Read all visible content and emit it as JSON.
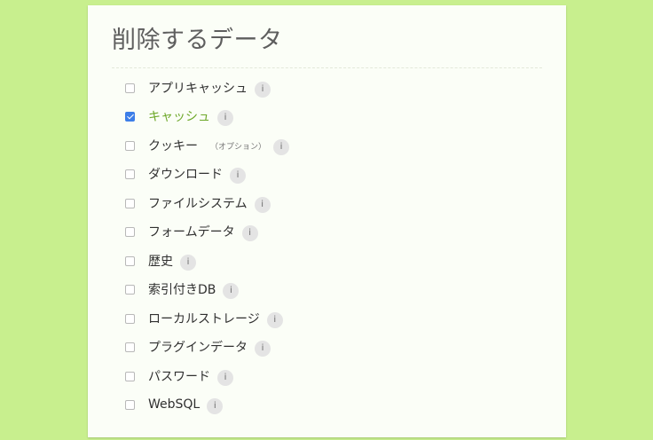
{
  "page": {
    "title": "削除するデータ"
  },
  "items": [
    {
      "label": "アプリキャッシュ",
      "checked": false,
      "info": "i"
    },
    {
      "label": "キャッシュ",
      "checked": true,
      "info": "i"
    },
    {
      "label": "クッキー",
      "optional": "（オプション）",
      "checked": false,
      "info": "i"
    },
    {
      "label": "ダウンロード",
      "checked": false,
      "info": "i"
    },
    {
      "label": "ファイルシステム",
      "checked": false,
      "info": "i"
    },
    {
      "label": "フォームデータ",
      "checked": false,
      "info": "i"
    },
    {
      "label": "歴史",
      "checked": false,
      "info": "i"
    },
    {
      "label": "索引付きDB",
      "checked": false,
      "info": "i"
    },
    {
      "label": "ローカルストレージ",
      "checked": false,
      "info": "i"
    },
    {
      "label": "プラグインデータ",
      "checked": false,
      "info": "i"
    },
    {
      "label": "パスワード",
      "checked": false,
      "info": "i"
    },
    {
      "label": "WebSQL",
      "checked": false,
      "info": "i"
    }
  ],
  "colors": {
    "background": "#c8ef8e",
    "panel": "#fbfef7",
    "checked_label": "#6ea82a",
    "checkbox_checked": "#3d7ee8"
  },
  "icons": {
    "info": "info-icon",
    "checkbox": "checkbox"
  }
}
